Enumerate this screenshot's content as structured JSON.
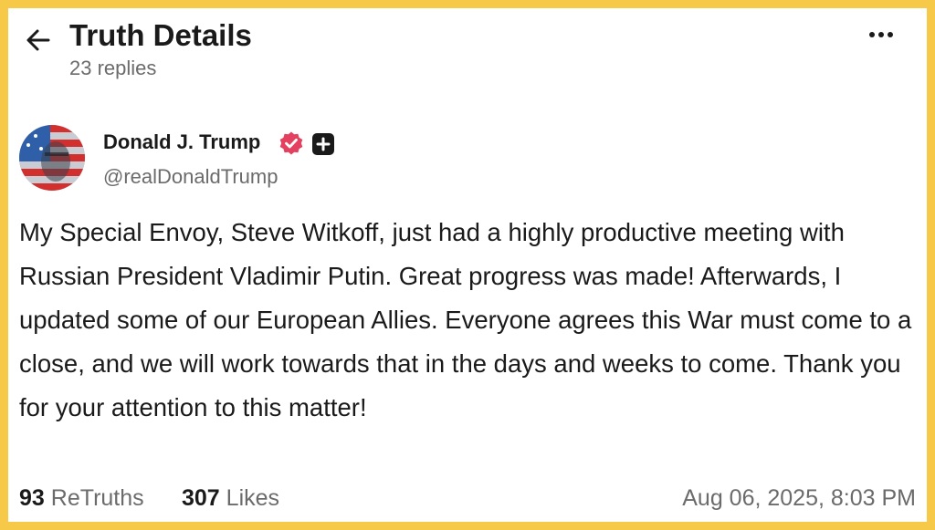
{
  "header": {
    "title": "Truth Details",
    "replies": "23 replies",
    "back_icon": "arrow-left-icon",
    "more_icon": "more-horizontal-icon"
  },
  "author": {
    "name": "Donald J. Trump",
    "handle": "@realDonaldTrump",
    "verified_icon": "verified-badge-icon",
    "plus_icon": "plus-badge-icon"
  },
  "post": {
    "text": "My Special Envoy, Steve Witkoff, just had a highly productive meeting with Russian President Vladimir Putin. Great progress was made! Afterwards, I updated some of our European Allies. Everyone agrees this War must come to a close, and we will work towards that in the days and weeks to come. Thank you for your attention to this matter!"
  },
  "stats": {
    "retruths_count": "93",
    "retruths_label": "ReTruths",
    "likes_count": "307",
    "likes_label": "Likes",
    "timestamp": "Aug 06, 2025, 8:03 PM"
  },
  "colors": {
    "frame": "#f7c948",
    "verified": "#e4405f",
    "text": "#1a1a1a",
    "muted": "#6b6b6b"
  }
}
